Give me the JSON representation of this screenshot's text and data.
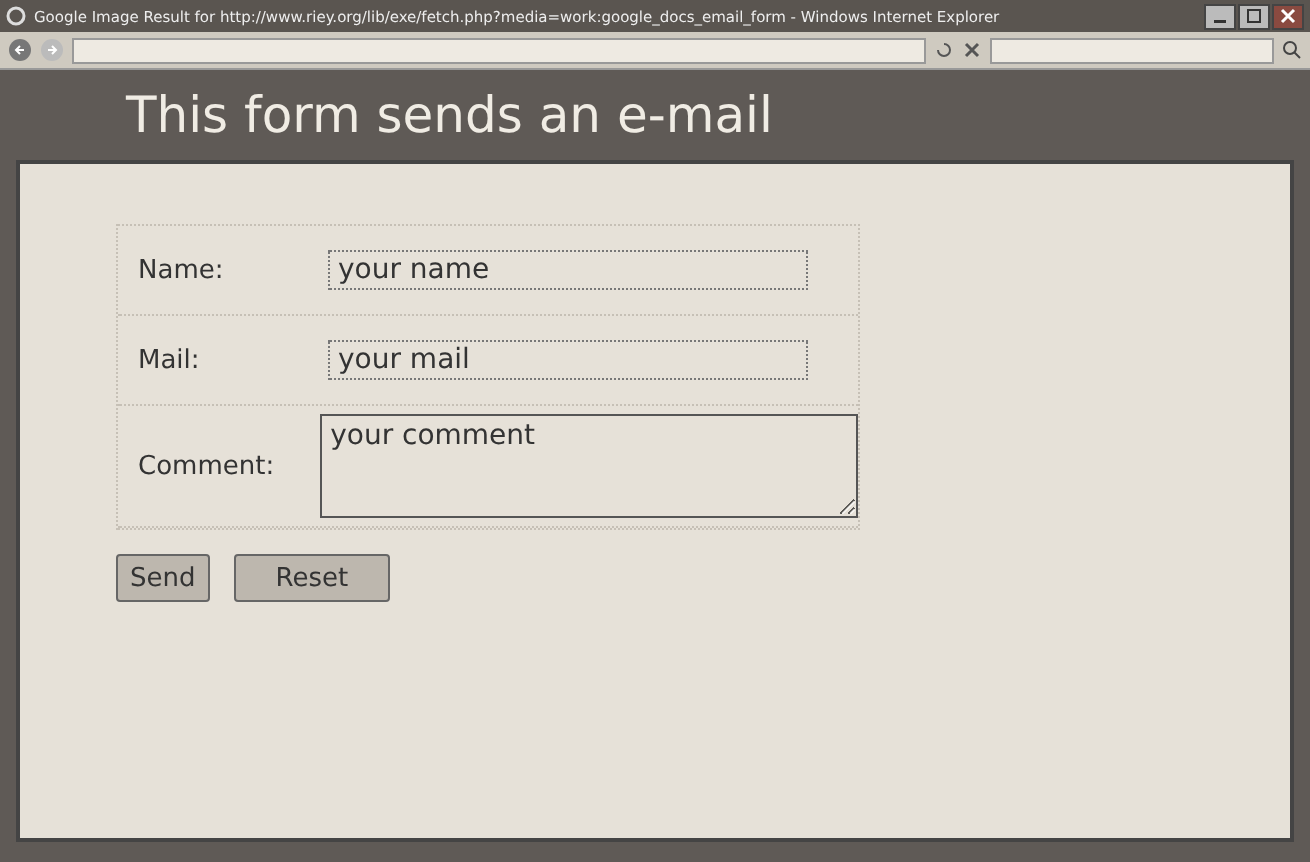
{
  "window": {
    "title": "Google Image Result for http://www.riey.org/lib/exe/fetch.php?media=work:google_docs_email_form - Windows Internet Explorer"
  },
  "page": {
    "heading": "This form sends an e-mail",
    "fields": [
      {
        "label": "Name:",
        "kind": "input",
        "value": "your name"
      },
      {
        "label": "Mail:",
        "kind": "input",
        "value": "your mail"
      },
      {
        "label": "Comment:",
        "kind": "textarea",
        "value": "your comment"
      }
    ],
    "buttons": [
      "Send",
      "Reset"
    ]
  }
}
